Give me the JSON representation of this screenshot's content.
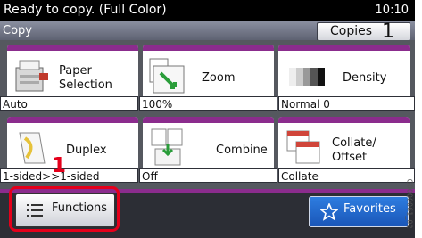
{
  "status": {
    "message": "Ready to copy. (Full Color)",
    "time": "10:10"
  },
  "title_bar": {
    "title": "Copy",
    "copies_label": "Copies",
    "copies_value": "1"
  },
  "tiles": [
    {
      "name": "Paper Selection",
      "line1": "Paper",
      "line2": "Selection",
      "value": "Auto",
      "icon": "printer-paper-icon"
    },
    {
      "name": "Zoom",
      "line1": "Zoom",
      "line2": "",
      "value": "100%",
      "icon": "zoom-icon"
    },
    {
      "name": "Density",
      "line1": "Density",
      "line2": "",
      "value": "Normal 0",
      "icon": "density-icon"
    },
    {
      "name": "Duplex",
      "line1": "Duplex",
      "line2": "",
      "value": "1-sided>>1-sided",
      "icon": "duplex-icon"
    },
    {
      "name": "Combine",
      "line1": "Combine",
      "line2": "",
      "value": "Off",
      "icon": "combine-icon"
    },
    {
      "name": "Collate/Offset",
      "line1": "Collate/",
      "line2": "Offset",
      "value": "Collate",
      "icon": "collate-icon"
    }
  ],
  "buttons": {
    "functions": "Functions",
    "favorites": "Favorites"
  },
  "callout_number": "1",
  "side_code": "G0000061_02",
  "colors": {
    "accent": "#8b2c8d",
    "highlight": "#e5001b",
    "favorites": "#1a56b8"
  }
}
